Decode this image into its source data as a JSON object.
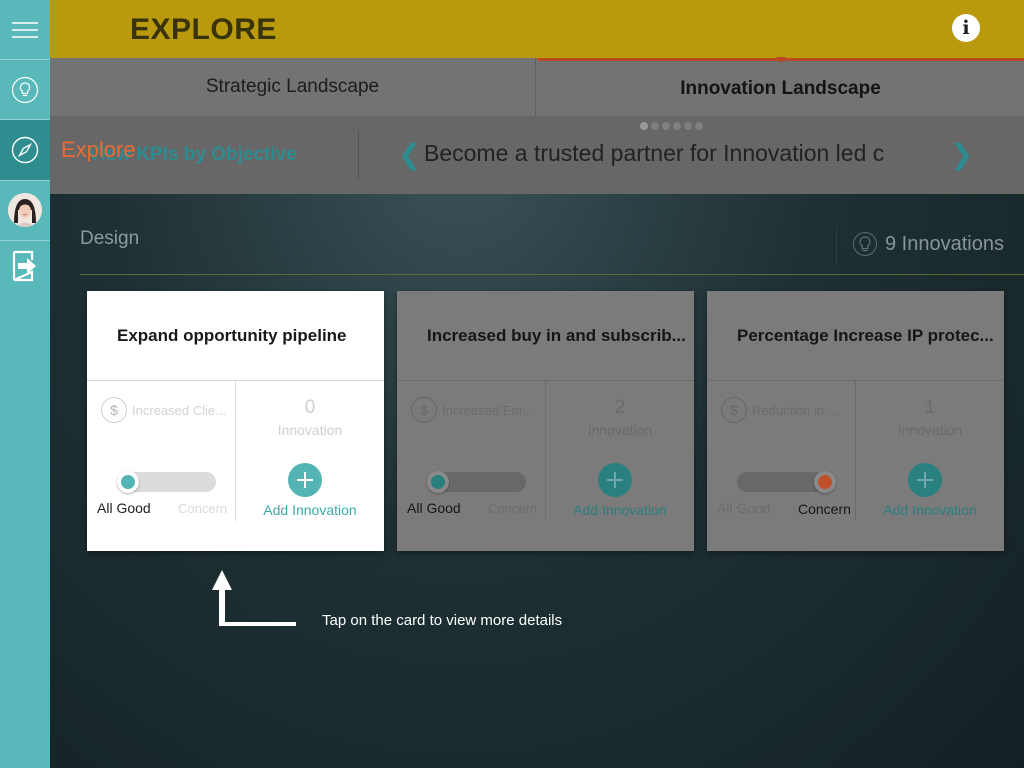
{
  "header": {
    "title": "EXPLORE"
  },
  "sidebar": {
    "items": [
      {
        "name": "menu",
        "icon": "hamburger-menu-icon"
      },
      {
        "name": "ideas",
        "icon": "lightbulb-icon"
      },
      {
        "name": "explore",
        "icon": "compass-icon"
      },
      {
        "name": "profile",
        "icon": "avatar"
      },
      {
        "name": "logout",
        "icon": "logout-icon"
      }
    ]
  },
  "tabs": [
    {
      "label": "Strategic Landscape",
      "active": false
    },
    {
      "label": "Innovation Landscape",
      "active": true
    }
  ],
  "objective_bar": {
    "view_kpis_label": "View KPIs by Objective",
    "objective_text": "Become a trusted partner for Innovation led c",
    "page_dots": 6
  },
  "explore_tip": "Explore",
  "section": {
    "title": "Design",
    "innovations_count": "9 Innovations"
  },
  "cards": [
    {
      "title": "Expand opportunity pipeline",
      "kpi": "Increased Clie...",
      "count": "0",
      "count_label": "Innovation",
      "status_left": "All Good",
      "status_right": "Concern",
      "add_label": "Add Innovation"
    },
    {
      "title": "Increased buy in and subscrib...",
      "kpi": "Increased Em...",
      "count": "2",
      "count_label": "Innovation",
      "status_left": "All Good",
      "status_right": "Concern",
      "add_label": "Add Innovation"
    },
    {
      "title": "Percentage Increase IP protec...",
      "kpi": "Reduction in ...",
      "count": "1",
      "count_label": "Innovation",
      "status_left": "All Good",
      "status_right": "Concern",
      "add_label": "Add Innovation"
    }
  ],
  "hint": {
    "text": "Tap on the card to view more details"
  },
  "colors": {
    "sidebar": "#58b8ba",
    "header": "#b99a0c",
    "accent_teal": "#52b5b4",
    "concern_red": "#c0502a",
    "active_tab_border": "#b94823",
    "explore_tip": "#ea6a35"
  }
}
